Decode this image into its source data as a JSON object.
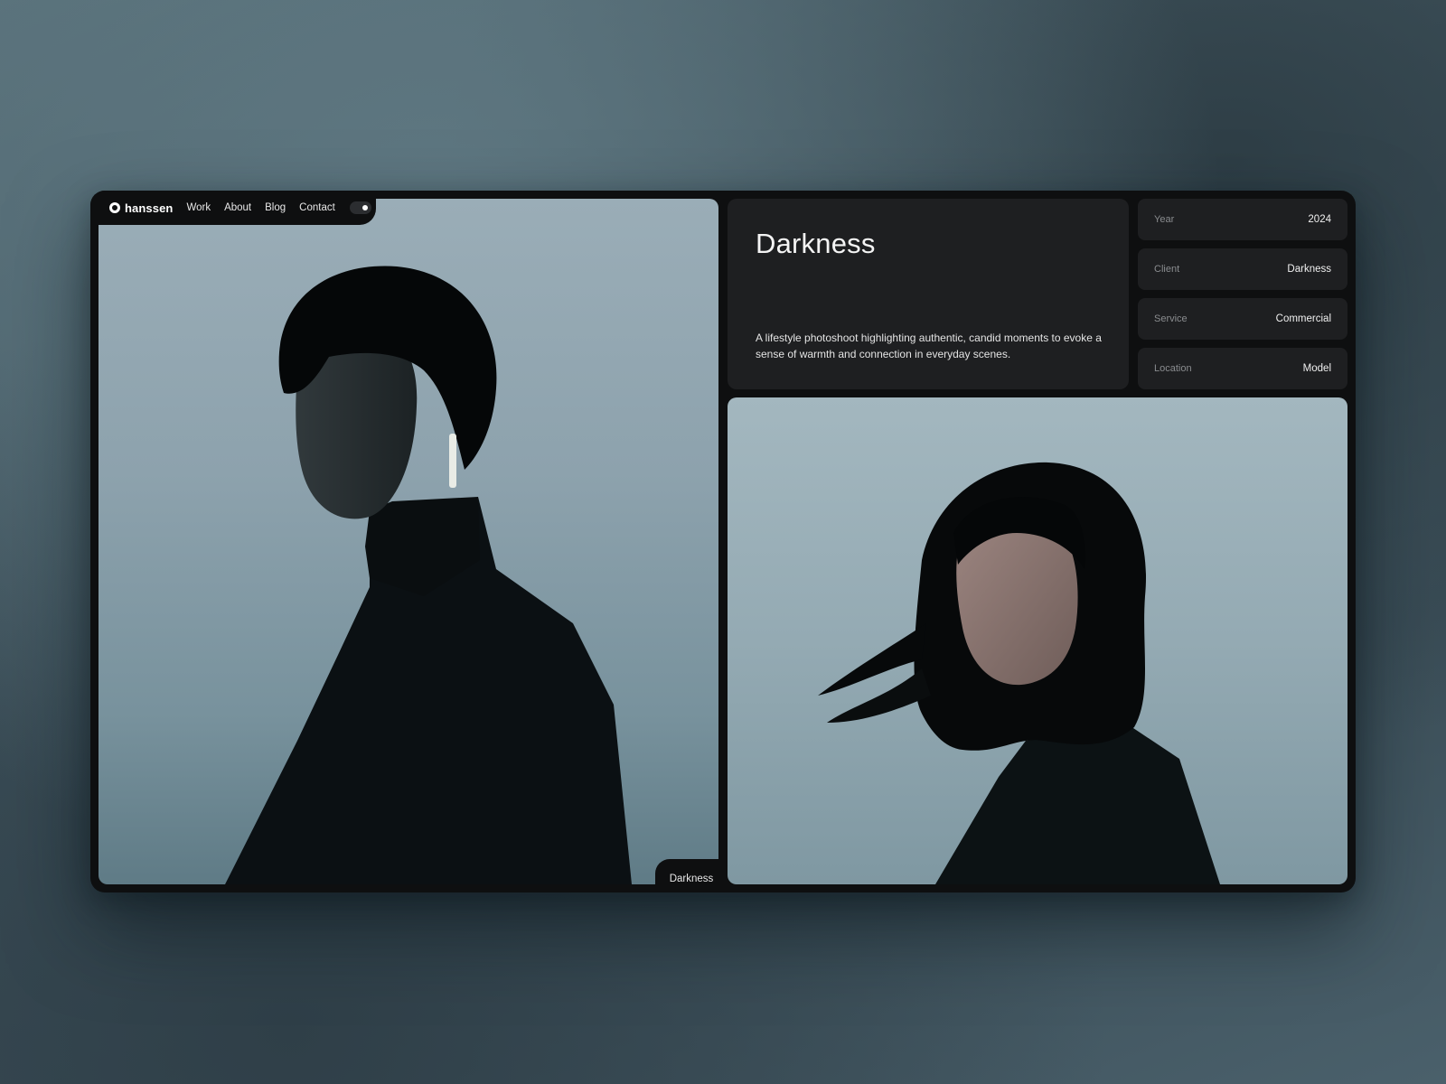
{
  "nav": {
    "brand": "hanssen",
    "links": [
      "Work",
      "About",
      "Blog",
      "Contact"
    ]
  },
  "project": {
    "title": "Darkness",
    "description": "A lifestyle photoshoot highlighting authentic, candid moments to evoke a sense of warmth and connection in everyday scenes.",
    "caption": "Darkness"
  },
  "meta": [
    {
      "label": "Year",
      "value": "2024"
    },
    {
      "label": "Client",
      "value": "Darkness"
    },
    {
      "label": "Service",
      "value": "Commercial"
    },
    {
      "label": "Location",
      "value": "Model"
    }
  ],
  "icons": {
    "logo": "ring-logo-icon",
    "theme_toggle": "theme-toggle"
  },
  "colors": {
    "frame": "#0e0f10",
    "card": "#1e1f21",
    "text": "#f2f2f2",
    "muted": "#8a8c8f"
  }
}
